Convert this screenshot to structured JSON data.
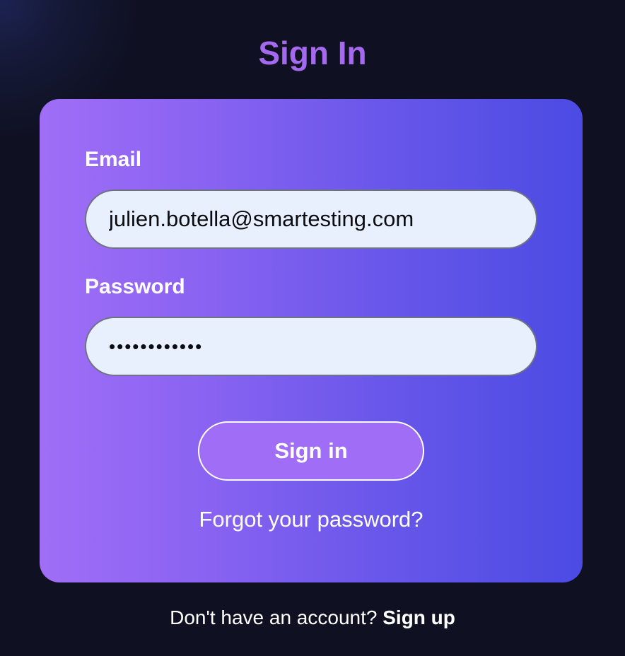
{
  "page": {
    "title": "Sign In"
  },
  "form": {
    "email_label": "Email",
    "email_value": "julien.botella@smartesting.com",
    "password_label": "Password",
    "password_value": "••••••••••••",
    "submit_label": "Sign in",
    "forgot_label": "Forgot your password?"
  },
  "footer": {
    "prompt": "Don't have an account?",
    "signup_label": "Sign up"
  },
  "colors": {
    "background": "#0f1022",
    "title": "#a469ef",
    "card_gradient_start": "#a06ef6",
    "card_gradient_end": "#4b4be3",
    "input_background": "#e8f0fe",
    "button_background": "#a06ef6"
  }
}
